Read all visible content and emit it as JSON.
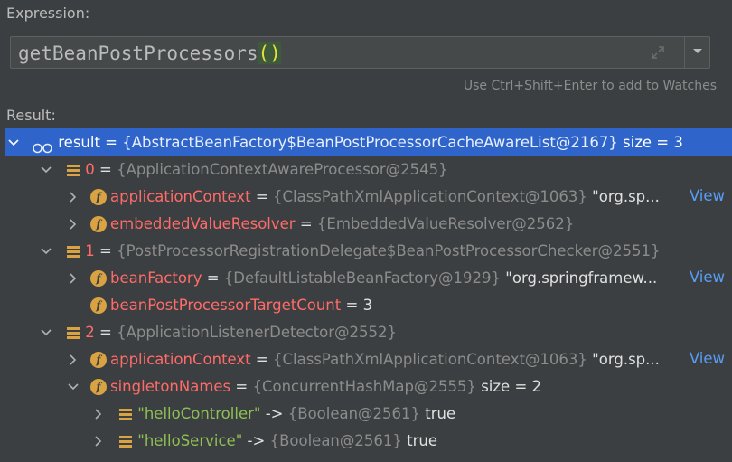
{
  "expression": {
    "label": "Expression:",
    "text_main": "getBeanPostProcessors",
    "text_parens": "()"
  },
  "hint": "Use Ctrl+Shift+Enter to add to Watches",
  "result_label": "Result:",
  "tree": {
    "root": {
      "name": "result",
      "eq": " = ",
      "ref": "{AbstractBeanFactory$BeanPostProcessorCacheAwareList@2167}",
      "size": "  size = 3"
    },
    "item0": {
      "name": "0",
      "eq": " = ",
      "ref": "{ApplicationContextAwareProcessor@2545}",
      "children": [
        {
          "name": "applicationContext",
          "eq": " = ",
          "ref": "{ClassPathXmlApplicationContext@1063}",
          "value": " \"org.sp",
          "ellipsis": "... ",
          "link": "View"
        },
        {
          "name": "embeddedValueResolver",
          "eq": " = ",
          "ref": "{EmbeddedValueResolver@2562}"
        }
      ]
    },
    "item1": {
      "name": "1",
      "eq": " = ",
      "ref": "{PostProcessorRegistrationDelegate$BeanPostProcessorChecker@2551}",
      "children": [
        {
          "name": "beanFactory",
          "eq": " = ",
          "ref": "{DefaultListableBeanFactory@1929}",
          "value": " \"org.springframew",
          "ellipsis": "... ",
          "link": "View"
        },
        {
          "name": "beanPostProcessorTargetCount",
          "eq": " = ",
          "value": "3"
        }
      ]
    },
    "item2": {
      "name": "2",
      "eq": " = ",
      "ref": "{ApplicationListenerDetector@2552}",
      "children": [
        {
          "name": "applicationContext",
          "eq": " = ",
          "ref": "{ClassPathXmlApplicationContext@1063}",
          "value": " \"org.sp",
          "ellipsis": "... ",
          "link": "View"
        },
        {
          "name": "singletonNames",
          "eq": " = ",
          "ref": "{ConcurrentHashMap@2555}",
          "size": "  size = 2"
        }
      ],
      "map_entries": [
        {
          "key": "\"helloController\"",
          "arrow": " -> ",
          "ref": "{Boolean@2561}",
          "value": " true"
        },
        {
          "key": "\"helloService\"",
          "arrow": " -> ",
          "ref": "{Boolean@2561}",
          "value": " true"
        }
      ]
    }
  },
  "colors": {
    "background": "#3c3f41",
    "selection": "#2f65ca",
    "field_name": "#ff6b68",
    "string": "#8fbf55",
    "link": "#589df6",
    "field_icon": "#d9a343"
  },
  "icons": {
    "field": "field-f-icon",
    "array": "array-element-icon",
    "watch": "watch-result-icon",
    "expand": "expand-editor-icon",
    "dropdown": "chevron-down-icon"
  }
}
